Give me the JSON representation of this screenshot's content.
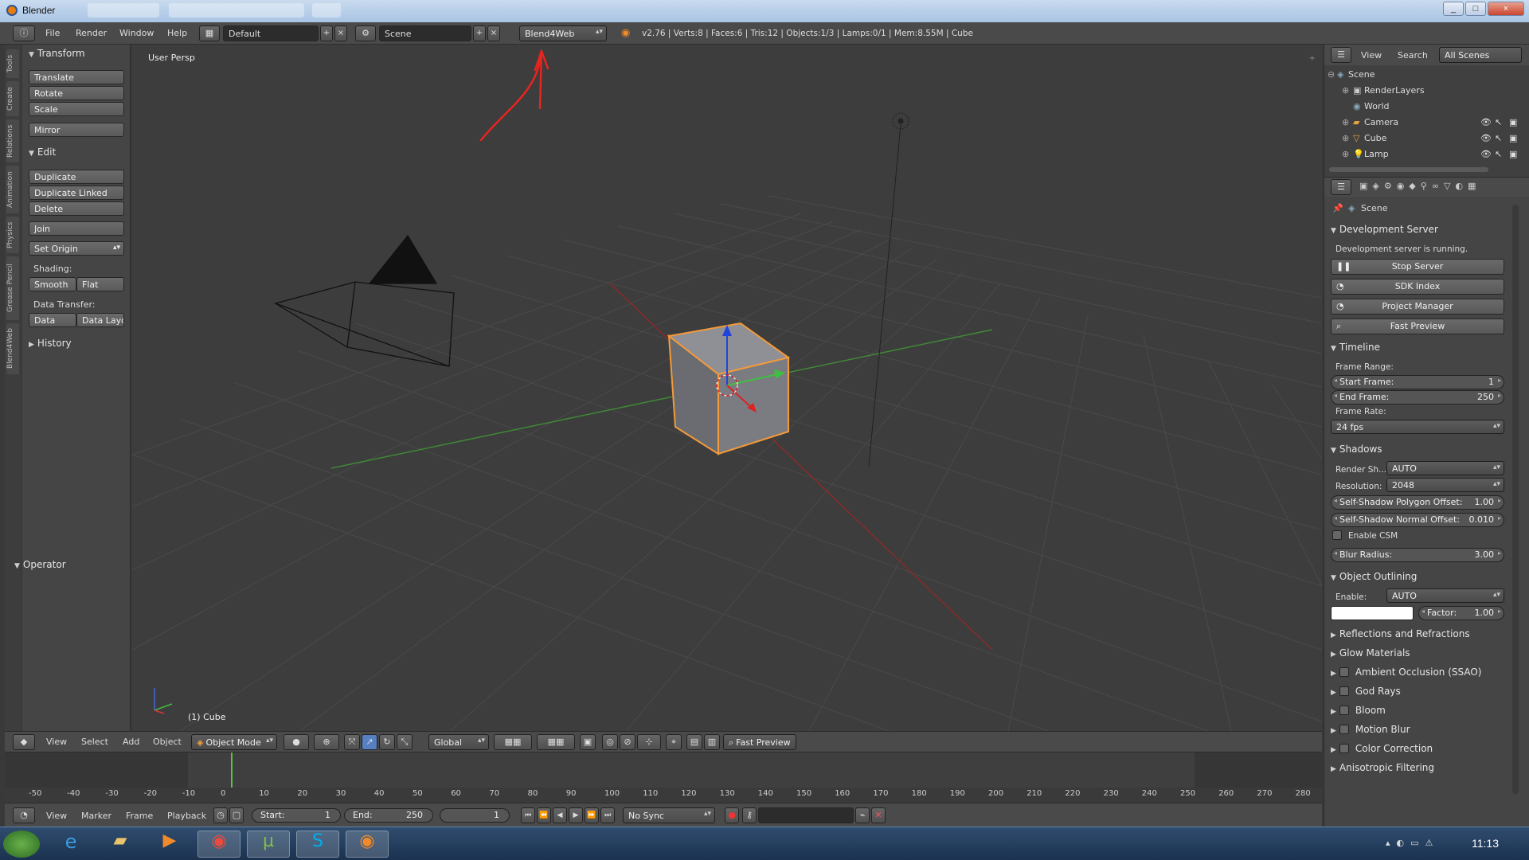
{
  "window": {
    "title": "Blender",
    "controls": [
      "_",
      "□",
      "×"
    ]
  },
  "top_header": {
    "menus": [
      "File",
      "Render",
      "Window",
      "Help"
    ],
    "screen_layout": "Default",
    "scene": "Scene",
    "engine": "Blend4Web",
    "stats": "v2.76 | Verts:8 | Faces:6 | Tris:12 | Objects:1/3 | Lamps:0/1 | Mem:8.55M | Cube"
  },
  "tool_tabs": [
    "Tools",
    "Create",
    "Relations",
    "Animation",
    "Physics",
    "Grease Pencil",
    "Blend4Web"
  ],
  "tool_shelf": {
    "transform": {
      "title": "Transform",
      "buttons": [
        "Translate",
        "Rotate",
        "Scale",
        "Mirror"
      ]
    },
    "edit": {
      "title": "Edit",
      "buttons": [
        "Duplicate",
        "Duplicate Linked",
        "Delete",
        "Join"
      ],
      "set_origin": "Set Origin",
      "shading_label": "Shading:",
      "smooth": "Smooth",
      "flat": "Flat",
      "data_transfer_label": "Data Transfer:",
      "data": "Data",
      "data_layout": "Data Layo"
    },
    "history": "History",
    "operator": "Operator"
  },
  "viewport": {
    "label": "User Persp",
    "object": "(1) Cube"
  },
  "viewport_header": {
    "menus": [
      "View",
      "Select",
      "Add",
      "Object"
    ],
    "mode": "Object Mode",
    "orientation": "Global",
    "fast_preview": "Fast Preview"
  },
  "timeline": {
    "ticks": [
      "-50",
      "-40",
      "-30",
      "-20",
      "-10",
      "0",
      "10",
      "20",
      "30",
      "40",
      "50",
      "60",
      "70",
      "80",
      "90",
      "100",
      "110",
      "120",
      "130",
      "140",
      "150",
      "160",
      "170",
      "180",
      "190",
      "200",
      "210",
      "220",
      "230",
      "240",
      "250",
      "260",
      "270",
      "280"
    ],
    "menus": [
      "View",
      "Marker",
      "Frame",
      "Playback"
    ],
    "start_label": "Start:",
    "start": "1",
    "end_label": "End:",
    "end": "250",
    "current": "1",
    "sync": "No Sync"
  },
  "outliner": {
    "menus": [
      "View",
      "Search"
    ],
    "filter": "All Scenes",
    "items": [
      "Scene",
      "RenderLayers",
      "World",
      "Camera",
      "Cube",
      "Lamp"
    ]
  },
  "properties": {
    "context": "Scene",
    "dev_server": {
      "title": "Development Server",
      "status": "Development server is running.",
      "buttons": [
        "Stop Server",
        "SDK Index",
        "Project Manager",
        "Fast Preview"
      ]
    },
    "timeline": {
      "title": "Timeline",
      "frame_range": "Frame Range:",
      "start_label": "Start Frame:",
      "start": "1",
      "end_label": "End Frame:",
      "end": "250",
      "frame_rate_label": "Frame Rate:",
      "frame_rate": "24 fps"
    },
    "shadows": {
      "title": "Shadows",
      "render_label": "Render Sh...",
      "render_value": "AUTO",
      "resolution_label": "Resolution:",
      "resolution_value": "2048",
      "poly_offset_label": "Self-Shadow Polygon Offset:",
      "poly_offset": "1.00",
      "normal_offset_label": "Self-Shadow Normal Offset:",
      "normal_offset": "0.010",
      "csm": "Enable CSM",
      "blur_label": "Blur Radius:",
      "blur": "3.00"
    },
    "outlining": {
      "title": "Object Outlining",
      "enable_label": "Enable:",
      "enable_value": "AUTO",
      "factor_label": "Factor:",
      "factor": "1.00"
    },
    "collapsed_panels": [
      "Reflections and Refractions",
      "Glow Materials"
    ],
    "checked_panels": [
      "Ambient Occlusion (SSAO)",
      "God Rays",
      "Bloom",
      "Motion Blur",
      "Color Correction"
    ],
    "last_panel": "Anisotropic Filtering"
  },
  "taskbar": {
    "time": "11:13"
  },
  "colors": {
    "annotation_arrow": "#e8241f",
    "selection_outline": "#f39a3a",
    "x_axis": "#c43232",
    "y_axis": "#4caa3c"
  }
}
